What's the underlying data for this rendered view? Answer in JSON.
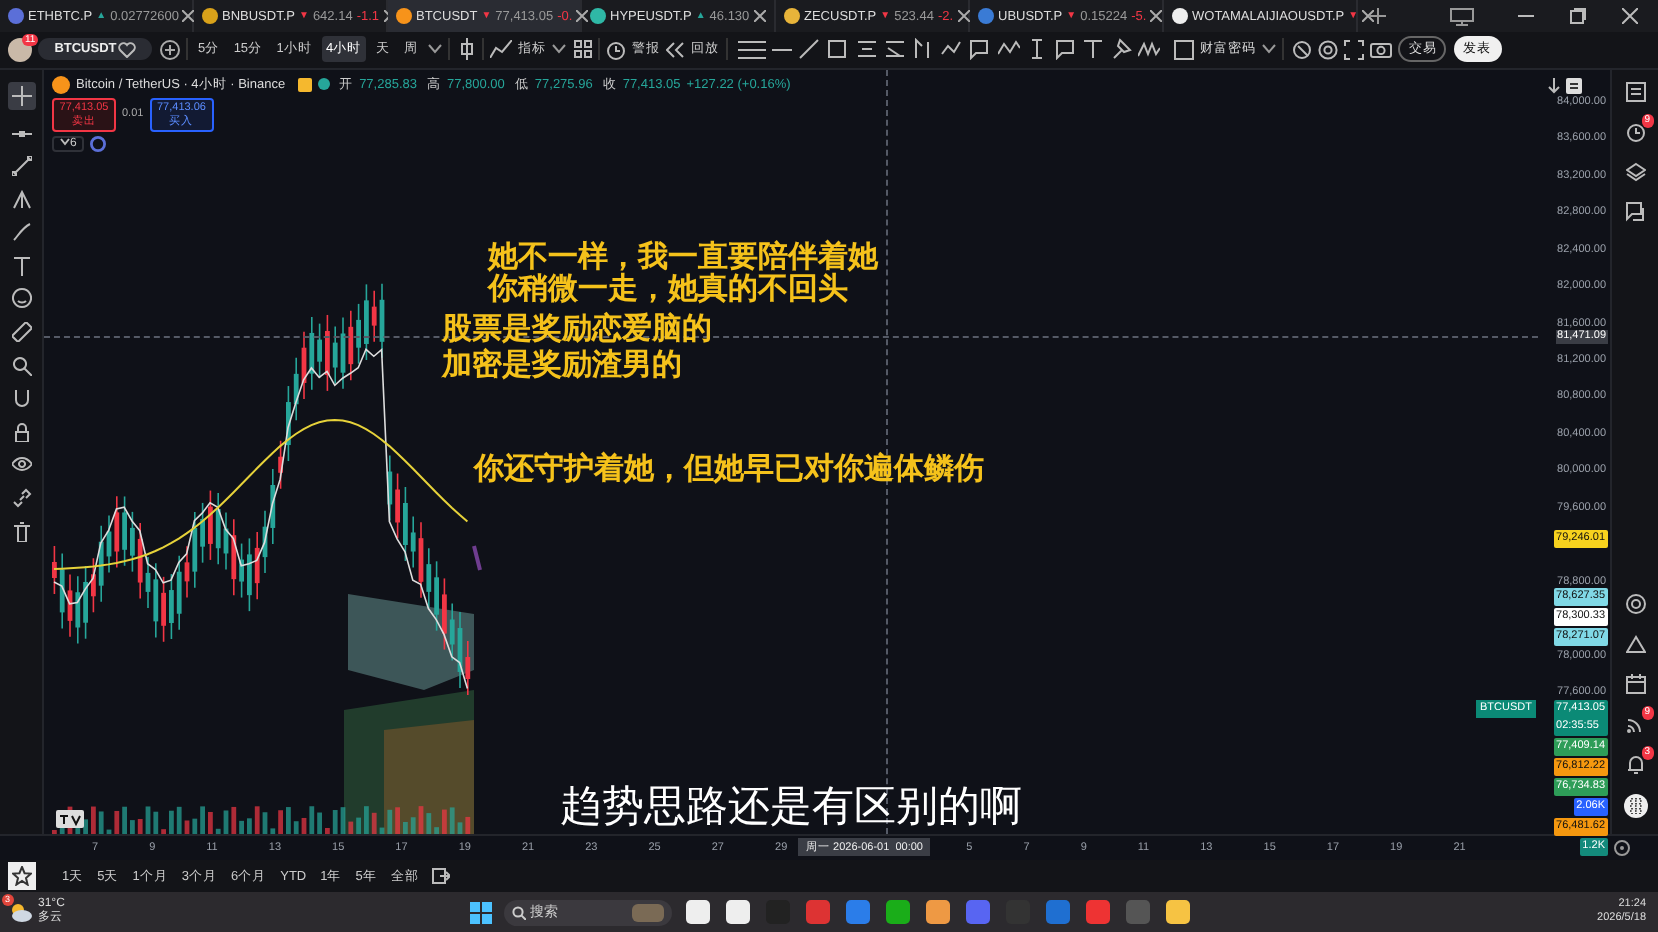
{
  "tabs": [
    {
      "symbol": "ETHBTC.P",
      "arrow": "▲",
      "color": "#26a69a",
      "price": "0.02772600",
      "selected": false
    },
    {
      "symbol": "BNBUSDT.P",
      "arrow": "▼",
      "color": "#f23645",
      "price": "642.14",
      "change": "-1.1",
      "selected": false
    },
    {
      "symbol": "BTCUSDT",
      "arrow": "▼",
      "color": "#f23645",
      "price": "77,413.05",
      "change": "-0.",
      "selected": true
    },
    {
      "symbol": "HYPEUSDT.P",
      "arrow": "▲",
      "color": "#26a69a",
      "price": "46.130",
      "selected": false
    },
    {
      "symbol": "ZECUSDT.P",
      "arrow": "▼",
      "color": "#f23645",
      "price": "523.44",
      "change": "-2.",
      "selected": false
    },
    {
      "symbol": "UBUSDT.P",
      "arrow": "▼",
      "color": "#f23645",
      "price": "0.15224",
      "change": "-5.",
      "selected": false
    },
    {
      "symbol": "WOTAMALAIJIAOUSDT.P",
      "arrow": "▼",
      "color": "#f23645",
      "selected": false
    }
  ],
  "toolbar": {
    "avatar_badge": "11",
    "symbol": "BTCUSDT",
    "intervals": [
      {
        "label": "5分",
        "selected": false
      },
      {
        "label": "15分",
        "selected": false
      },
      {
        "label": "1小时",
        "selected": false
      },
      {
        "label": "4小时",
        "selected": true
      },
      {
        "label": "天",
        "selected": false
      },
      {
        "label": "周",
        "selected": false
      }
    ],
    "indicators_label": "指标",
    "alert_label": "警报",
    "replay_label": "回放",
    "layout_name": "财富密码",
    "trade_button": "交易",
    "publish_button": "发表"
  },
  "legend": {
    "title": "Bitcoin / TetherUS · 4小时 · Binance",
    "ohlc": [
      {
        "key": "开",
        "value": "77,285.83"
      },
      {
        "key": "高",
        "value": "77,800.00"
      },
      {
        "key": "低",
        "value": "77,275.96"
      },
      {
        "key": "收",
        "value": "77,413.05"
      }
    ],
    "change": "+127.22 (+0.16%)",
    "sell": {
      "price": "77,413.05",
      "label": "卖出"
    },
    "spread": "0.01",
    "buy": {
      "price": "77,413.06",
      "label": "买入"
    },
    "indicator_count": "6"
  },
  "annotations": [
    "她不一样，我一直要陪伴着她",
    "你稍微一走，她真的不回头",
    "股票是奖励恋爱脑的",
    "加密是奖励渣男的",
    "你还守护着她，但她早已对你遍体鳞伤"
  ],
  "subtitle": "趋势思路还是有区别的啊",
  "price_axis": {
    "ticks": [
      "84,000.00",
      "83,600.00",
      "83,200.00",
      "82,800.00",
      "82,400.00",
      "82,000.00",
      "81,600.00",
      "81,200.00",
      "80,800.00",
      "80,400.00",
      "80,000.00",
      "79,600.00",
      "78,800.00",
      "78,000.00",
      "77,600.00"
    ],
    "crosshair_price": "81,471.09",
    "symbol_tag": "BTCUSDT",
    "tag_groups": [
      [
        {
          "text": "79,246.01",
          "color": "#f7d21e"
        }
      ],
      [
        {
          "text": "78,627.35",
          "color": "#80d8e6"
        },
        {
          "text": "78,300.33",
          "color": "#ffffff"
        },
        {
          "text": "78,271.07",
          "color": "#80d8e6"
        }
      ],
      [
        {
          "text": "77,413.05",
          "sub": "02:35:55",
          "color": "#0b8a76"
        },
        {
          "text": "77,409.14",
          "color": "#2e9d58"
        },
        {
          "text": "76,812.22",
          "color": "#f5980f"
        },
        {
          "text": "76,734.83",
          "color": "#2e9d58"
        },
        {
          "text": "2.06K",
          "color": "#2962ff"
        },
        {
          "text": "76,481.62",
          "color": "#f5980f"
        },
        {
          "text": "1.2K",
          "color": "#138a7c"
        }
      ]
    ]
  },
  "right_badges": [
    "9",
    "9",
    "3"
  ],
  "time_axis": {
    "labels": [
      "7",
      "9",
      "11",
      "13",
      "15",
      "17",
      "19",
      "21",
      "23",
      "25",
      "27",
      "29",
      "5",
      "7",
      "9",
      "11",
      "13",
      "15",
      "17",
      "19",
      "21"
    ],
    "crosshair_date": "周一  2026-06-01",
    "crosshair_time": "00:00"
  },
  "ranges": [
    "1天",
    "5天",
    "1个月",
    "3个月",
    "6个月",
    "YTD",
    "1年",
    "5年",
    "全部"
  ],
  "taskbar": {
    "weather_badge": "3",
    "temperature": "31°C",
    "weather": "多云",
    "search_placeholder": "搜索",
    "time": "21:24",
    "date": "2026/5/18"
  }
}
